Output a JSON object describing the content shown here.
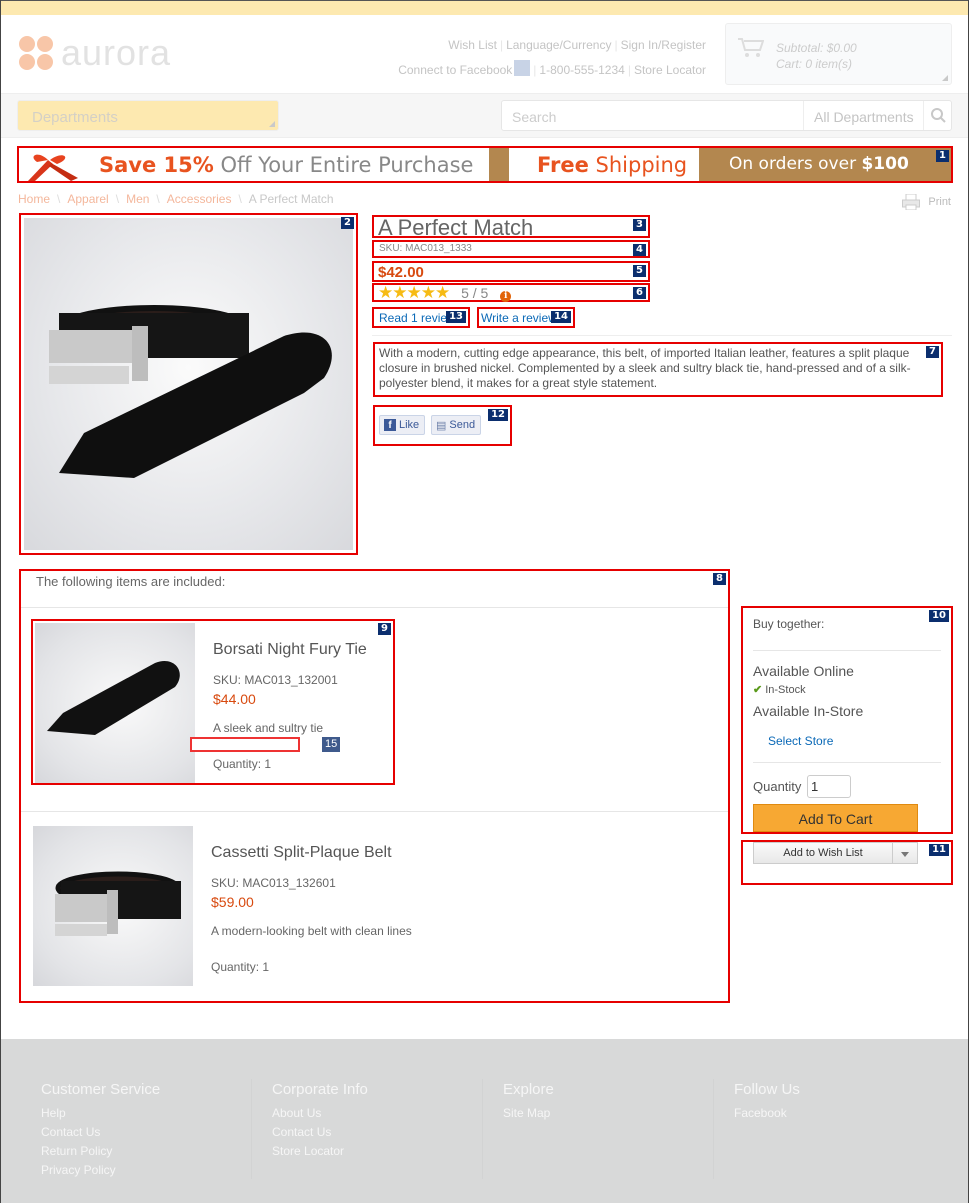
{
  "header": {
    "logo_text": "aurora",
    "links_row1": [
      "Wish List",
      "Language/Currency",
      "Sign In/Register"
    ],
    "links_row2": [
      "Connect to Facebook",
      "1-800-555-1234",
      "Store Locator"
    ],
    "cart": {
      "subtotal": "Subtotal: $0.00",
      "items": "Cart: 0 item(s)"
    }
  },
  "nav": {
    "departments_label": "Departments",
    "search_placeholder": "Search",
    "search_scope": "All Departments"
  },
  "promo": {
    "save_highlight": "Save 15%",
    "save_rest": " Off Your Entire Purchase",
    "free_bold": "Free",
    "free_rest": " Shipping",
    "orders_text": "On orders over ",
    "orders_amount": "$100"
  },
  "breadcrumb": [
    "Home",
    "Apparel",
    "Men",
    "Accessories",
    "A Perfect Match"
  ],
  "print_label": "Print",
  "product": {
    "title": "A Perfect Match",
    "sku": "SKU: MAC013_1333",
    "price": "$42.00",
    "rating_stars": "★★★★★",
    "rating_text": "5 / 5",
    "read_reviews": "Read 1 review",
    "write_review": "Write a review",
    "description": "With a modern, cutting edge appearance, this belt, of imported Italian leather, features a split plaque closure in brushed nickel. Complemented by a sleek and sultry black tie, hand-pressed and of a silk-polyester blend, it makes for a great style statement.",
    "like_label": "Like",
    "send_label": "Send"
  },
  "included": {
    "header": "The following items are included:",
    "items": [
      {
        "name": "Borsati Night Fury Tie",
        "sku": "SKU: MAC013_132001",
        "price": "$44.00",
        "description": "A sleek and sultry tie",
        "quantity": "Quantity: 1"
      },
      {
        "name": "Cassetti Split-Plaque Belt",
        "sku": "SKU: MAC013_132601",
        "price": "$59.00",
        "description": "A modern-looking belt with clean lines",
        "quantity": "Quantity: 1"
      }
    ]
  },
  "buy_box": {
    "title": "Buy together:",
    "available_online": "Available Online",
    "in_stock": "In-Stock",
    "available_store": "Available In-Store",
    "select_store": "Select Store",
    "quantity_label": "Quantity",
    "quantity_value": "1",
    "add_to_cart": "Add To Cart",
    "add_to_wishlist": "Add to Wish List"
  },
  "badges": [
    "1",
    "2",
    "3",
    "4",
    "5",
    "6",
    "7",
    "8",
    "9",
    "10",
    "11",
    "12",
    "13",
    "14",
    "15"
  ],
  "footer": {
    "columns": [
      {
        "title": "Customer Service",
        "links": [
          "Help",
          "Contact Us",
          "Return Policy",
          "Privacy Policy"
        ]
      },
      {
        "title": "Corporate Info",
        "links": [
          "About Us",
          "Contact Us",
          "Store Locator"
        ]
      },
      {
        "title": "Explore",
        "links": [
          "Site Map"
        ]
      },
      {
        "title": "Follow Us",
        "links": [
          "Facebook"
        ]
      }
    ]
  },
  "colors": {
    "accent_orange": "#d84a0f",
    "link_blue": "#0b69b7",
    "cart_button": "#f7a833",
    "annotation_red": "#e60000",
    "badge_navy": "#0b2e6e"
  }
}
